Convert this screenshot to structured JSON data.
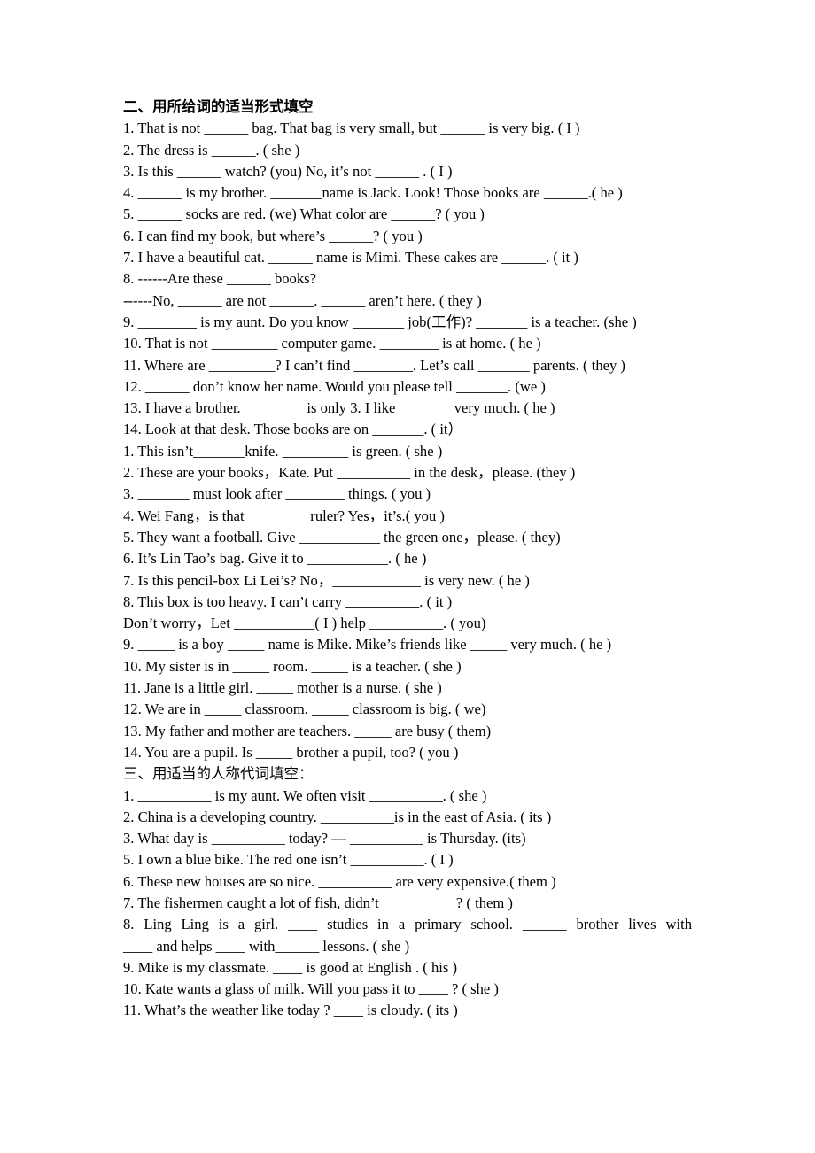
{
  "document": {
    "type": "worksheet",
    "language": "zh-CN / en",
    "background_color": "#ffffff",
    "text_color": "#000000"
  },
  "section_two": {
    "heading": "二、用所给词的适当形式填空",
    "items": [
      "1. That is not ______ bag. That bag is very small, but ______ is very big. ( I )",
      "2. The dress is ______. ( she )",
      "3. Is this ______ watch? (you) No, it’s not ______ . ( I )",
      "4. ______ is my brother. _______name is Jack. Look! Those books are ______.( he )",
      "5. ______ socks are red. (we) What color are ______? ( you )",
      "6. I can find my book, but where’s ______? ( you )",
      "7. I have a beautiful cat. ______ name is Mimi. These cakes are ______. ( it )",
      "8. ------Are these ______ books?",
      "------No, ______ are not ______. ______ aren’t here. ( they )",
      "9. ________ is my aunt. Do you know _______ job(工作)? _______ is a teacher. (she )",
      "10. That is not _________ computer game. ________ is at home. ( he )",
      "11. Where are _________? I can’t find ________. Let’s call _______ parents. ( they )",
      "12. ______ don’t know her name. Would you please tell _______. (we )",
      "13. I have a brother. ________ is only 3. I like _______ very much. ( he )",
      "14. Look at that desk. Those books are on _______. ( it）"
    ],
    "items_part2": [
      "1. This isn’t_______knife. _________ is green. ( she )",
      "2. These are your books，Kate. Put __________ in the desk，please. (they )",
      "3. _______ must look after ________ things. ( you )",
      "4. Wei Fang，is that ________ ruler? Yes，it’s.( you )",
      "5. They want a football. Give ___________ the green one，please. ( they)",
      "6. It’s Lin Tao’s bag. Give it to ___________. ( he )",
      "7. Is this pencil-box Li Lei’s? No，____________ is very new. ( he )",
      "8. This box is too heavy. I can’t carry __________. ( it )",
      "Don’t worry，Let ___________( I ) help __________. ( you)",
      "9. _____ is a boy _____ name is Mike. Mike’s friends like _____ very much. ( he )",
      "10. My sister is in _____ room. _____ is a teacher. ( she )",
      "11. Jane is a little girl. _____ mother is a nurse. ( she )",
      "12. We are in _____ classroom. _____ classroom is big. ( we)",
      "13. My father and mother are teachers. _____ are busy ( them)",
      "14. You are a pupil. Is _____ brother a pupil, too? ( you )"
    ]
  },
  "section_three": {
    "heading": "三、用适当的人称代词填空：",
    "items": [
      "1. __________ is my aunt. We often visit __________. ( she )",
      "2. China is a developing country. __________is in the east of Asia. ( its )",
      "3. What day is __________ today? — __________ is Thursday. (its)",
      "5. I own a blue bike. The red one isn’t __________. ( I )",
      "6. These new houses are so nice. __________ are very expensive.( them )",
      "7. The fishermen caught a lot of fish, didn’t __________? ( them )"
    ],
    "item8_line1": "8. Ling Ling is a girl. ____ studies in a primary school. ______ brother lives with",
    "item8_line2": "____ and helps ____ with______ lessons. ( she )",
    "items_tail": [
      "9. Mike is my classmate. ____ is good at English . ( his )",
      "10. Kate wants a glass of milk. Will you pass it to ____ ? ( she )",
      "11. What’s the weather like today ? ____ is cloudy. ( its )"
    ]
  }
}
